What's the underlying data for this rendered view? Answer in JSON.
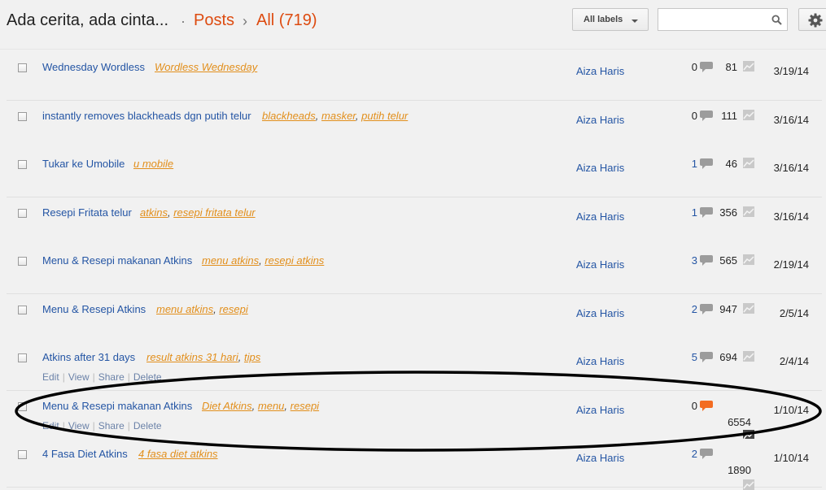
{
  "header": {
    "blog_title": "Ada cerita, ada cinta...",
    "dot": "·",
    "posts": "Posts",
    "arrow": "›",
    "all": "All (719)",
    "labels_button": "All labels",
    "search_placeholder": ""
  },
  "colors": {
    "accent_orange": "#dd4b10",
    "link_blue": "#2455a4",
    "label_orange": "#e28f1c",
    "comment_active": "#f36c21"
  },
  "icons": {
    "search": "search-icon",
    "settings": "gear-icon",
    "comment": "comment-bubble-icon",
    "views": "pageviews-chart-icon"
  },
  "posts": [
    {
      "title": "Wednesday Wordless",
      "labels": [
        "Wordless Wednesday"
      ],
      "author": "Aiza Haris",
      "comments": "0",
      "views": "81",
      "date": "3/19/14",
      "actions": []
    },
    {
      "title": "instantly removes blackheads dgn putih telur",
      "labels": [
        "blackheads",
        "masker",
        "putih telur"
      ],
      "author": "Aiza Haris",
      "comments": "0",
      "views": "111",
      "date": "3/16/14",
      "actions": []
    },
    {
      "title": "Tukar ke Umobile",
      "labels": [
        "u mobile"
      ],
      "author": "Aiza Haris",
      "comments": "1",
      "views": "46",
      "date": "3/16/14",
      "actions": []
    },
    {
      "title": "Resepi Fritata telur",
      "labels": [
        "atkins",
        "resepi fritata telur"
      ],
      "author": "Aiza Haris",
      "comments": "1",
      "views": "356",
      "date": "3/16/14",
      "actions": []
    },
    {
      "title": "Menu & Resepi makanan Atkins",
      "labels": [
        "menu atkins",
        "resepi atkins"
      ],
      "author": "Aiza Haris",
      "comments": "3",
      "views": "565",
      "date": "2/19/14",
      "actions": []
    },
    {
      "title": "Menu & Resepi Atkins",
      "labels": [
        "menu atkins",
        "resepi"
      ],
      "author": "Aiza Haris",
      "comments": "2",
      "views": "947",
      "date": "2/5/14",
      "actions": []
    },
    {
      "title": "Atkins after 31 days",
      "labels": [
        "result atkins 31 hari",
        "tips"
      ],
      "author": "Aiza Haris",
      "comments": "5",
      "views": "694",
      "date": "2/4/14",
      "actions": [
        "Edit",
        "View",
        "Share",
        "Delete"
      ]
    },
    {
      "title": "Menu & Resepi makanan Atkins",
      "labels": [
        "Diet Atkins",
        "menu",
        "resepi"
      ],
      "author": "Aiza Haris",
      "comments": "0",
      "views": "6554",
      "date": "1/10/14",
      "actions": [
        "Edit",
        "View",
        "Share",
        "Delete"
      ]
    },
    {
      "title": "4 Fasa Diet Atkins",
      "labels": [
        "4 fasa diet atkins"
      ],
      "author": "Aiza Haris",
      "comments": "2",
      "views": "1890",
      "date": "1/10/14",
      "actions": []
    }
  ]
}
